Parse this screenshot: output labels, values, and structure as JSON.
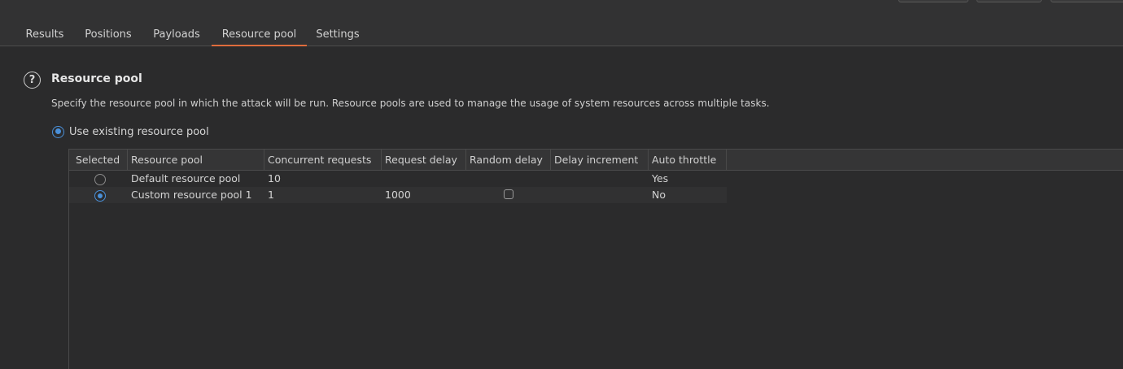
{
  "tabs": [
    {
      "label": "Results"
    },
    {
      "label": "Positions"
    },
    {
      "label": "Payloads"
    },
    {
      "label": "Resource pool",
      "active": true
    },
    {
      "label": "Settings"
    }
  ],
  "section": {
    "title": "Resource pool",
    "description": "Specify the resource pool in which the attack will be run. Resource pools are used to manage the usage of system resources across multiple tasks.",
    "option_label": "Use existing resource pool",
    "option_selected": true
  },
  "table": {
    "headers": [
      "Selected",
      "Resource pool",
      "Concurrent requests",
      "Request delay",
      "Random delay",
      "Delay increment",
      "Auto throttle"
    ],
    "rows": [
      {
        "selected": false,
        "name": "Default resource pool",
        "concurrent": "10",
        "request_delay": "",
        "random_delay": null,
        "delay_increment": "",
        "auto_throttle": "Yes"
      },
      {
        "selected": true,
        "name": "Custom resource pool 1",
        "concurrent": "1",
        "request_delay": "1000",
        "random_delay": false,
        "delay_increment": "",
        "auto_throttle": "No"
      }
    ]
  },
  "colors": {
    "accent_tab": "#e06c3c",
    "radio_selected": "#4a90d9",
    "background": "#2b2b2c"
  }
}
